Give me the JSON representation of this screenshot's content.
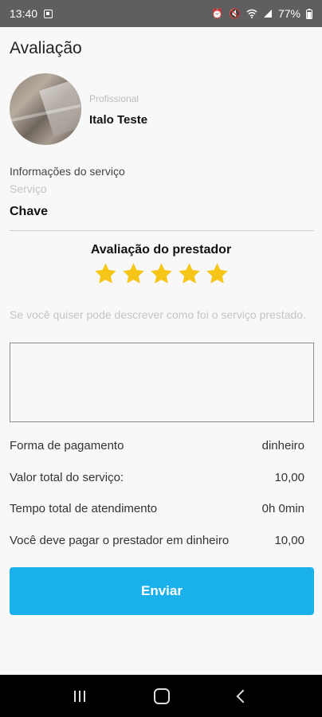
{
  "status_bar": {
    "time": "13:40",
    "battery": "77%"
  },
  "screen": {
    "title": "Avaliação"
  },
  "professional": {
    "label": "Profissional",
    "name": "Italo Teste"
  },
  "service": {
    "info_label": "Informações do serviço",
    "label": "Serviço",
    "value": "Chave"
  },
  "rating": {
    "title": "Avaliação do prestador",
    "stars": 5,
    "max_stars": 5,
    "star_color": "#f5c518"
  },
  "review": {
    "hint": "Se você quiser pode descrever como foi o serviço prestado.",
    "value": ""
  },
  "details": [
    {
      "label": "Forma de pagamento",
      "value": "dinheiro"
    },
    {
      "label": "Valor total do serviço:",
      "value": "10,00"
    },
    {
      "label": "Tempo total de atendimento",
      "value": "0h 0min"
    },
    {
      "label": "Você deve pagar o prestador em dinheiro",
      "value": "10,00"
    }
  ],
  "submit": {
    "label": "Enviar",
    "color": "#1ab0ec"
  }
}
